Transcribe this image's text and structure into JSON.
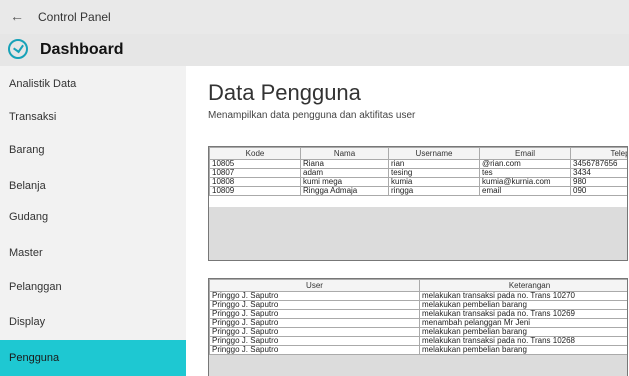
{
  "window": {
    "back_symbol": "←",
    "title": "Control Panel"
  },
  "app": {
    "icon": "check-circle-icon",
    "title": "Dashboard",
    "accent": "#1ec8d2"
  },
  "sidebar": {
    "items": [
      {
        "label": "Analistik Data"
      },
      {
        "label": "Transaksi"
      },
      {
        "label": "Barang"
      },
      {
        "label": "Belanja"
      },
      {
        "label": "Gudang"
      },
      {
        "label": "Master"
      },
      {
        "label": "Pelanggan"
      },
      {
        "label": "Display"
      },
      {
        "label": "Pengguna",
        "active": true
      }
    ]
  },
  "main": {
    "title": "Data Pengguna",
    "subtitle": "Menampilkan data pengguna dan aktifitas user",
    "users_table": {
      "columns": [
        "Kode",
        "Nama",
        "Username",
        "Email",
        "Telep"
      ],
      "rows": [
        [
          "10805",
          "Riana",
          "rian",
          "@rian.com",
          "3456787656"
        ],
        [
          "10807",
          "adam",
          "tesing",
          "tes",
          "3434"
        ],
        [
          "10808",
          "kumi mega",
          "kumia",
          "kumia@kurnia.com",
          "980"
        ],
        [
          "10809",
          "Ringga Admaja",
          "ringga",
          "email",
          "090"
        ]
      ]
    },
    "activity_table": {
      "columns": [
        "User",
        "Keterangan"
      ],
      "rows": [
        [
          "Pringgo J. Saputro",
          "melakukan transaksi pada no. Trans 10270"
        ],
        [
          "Pringgo J. Saputro",
          "melakukan pembelian barang"
        ],
        [
          "Pringgo J. Saputro",
          "melakukan transaksi pada no. Trans 10269"
        ],
        [
          "Pringgo J. Saputro",
          "menambah pelanggan Mr Jeni"
        ],
        [
          "Pringgo J. Saputro",
          "melakukan pembelian barang"
        ],
        [
          "Pringgo J. Saputro",
          "melakukan transaksi pada no. Trans 10268"
        ],
        [
          "Pringgo J. Saputro",
          "melakukan pembelian barang"
        ]
      ]
    }
  }
}
